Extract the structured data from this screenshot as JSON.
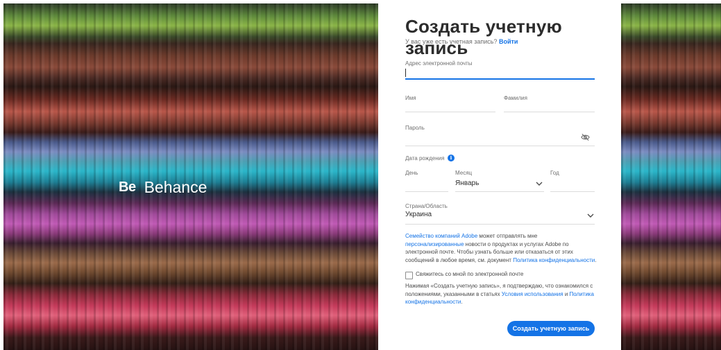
{
  "brand": {
    "mark": "Be",
    "name": "Behance"
  },
  "form": {
    "title": "Создать учетную запись",
    "have_account_text": "У вас уже есть учетная запись?",
    "sign_in_link": "Войти",
    "email_label": "Адрес электронной почты",
    "email_value": "",
    "first_name_label": "Имя",
    "last_name_label": "Фамилия",
    "password_label": "Пароль",
    "dob_label": "Дата рождения",
    "day_label": "День",
    "month_label": "Месяц",
    "month_value": "Январь",
    "year_label": "Год",
    "country_label": "Страна/Область",
    "country_value": "Украина",
    "consent_pre_link": "Семейство компаний Adobe",
    "consent_mid": " может отправлять мне ",
    "consent_link2": "персонализированные",
    "consent_post": " новости о продуктах и услугах Adobe по электронной почте. Чтобы узнать больше или отказаться от этих сообщений в любое время, см. документ ",
    "privacy_link": "Политика конфиденциальности",
    "checkbox_label": "Свяжитесь со мной по электронной почте",
    "terms_pre": "Нажимая «Создать учетную запись», я подтверждаю, что ознакомился с положениями, указанными в статьях ",
    "terms_link": "Условия использования",
    "terms_and": " и ",
    "privacy_link2": "Политика конфиденциальности",
    "submit_label": "Создать учетную запись"
  },
  "colors": {
    "accent": "#1473e6",
    "text": "#2c2c2c",
    "muted": "#6e6e6e"
  },
  "icons": [
    "eye-off-icon",
    "info-icon",
    "chevron-down-icon"
  ]
}
